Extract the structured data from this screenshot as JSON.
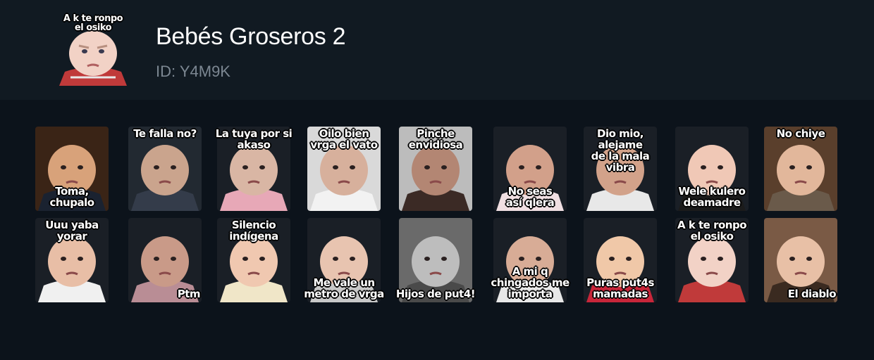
{
  "pack": {
    "title": "Bebés Groseros 2",
    "id_text": "ID: Y4M9K",
    "thumbnail_caption": "A k te ronpo\nel osiko"
  },
  "stickers": [
    {
      "caption": "Toma,\nchupalo",
      "pos": "bottom",
      "bg": "#3a2416",
      "skin": "#d8a27a",
      "shirt": "#1a2230"
    },
    {
      "caption": "Te falla no?",
      "pos": "top",
      "bg": "#222931",
      "skin": "#caa48d",
      "shirt": "#343c4a"
    },
    {
      "caption": "La tuya por si\nakaso",
      "pos": "top",
      "bg": "#1a1f26",
      "skin": "#d9b6a4",
      "shirt": "#e7a8b7"
    },
    {
      "caption": "Oilo bien\nvrga el vato",
      "pos": "top",
      "bg": "#d9d9d9",
      "skin": "#d7b09c",
      "shirt": "#f2f2f2"
    },
    {
      "caption": "Pinche\nenvidiosa",
      "pos": "top",
      "bg": "#bcbcbc",
      "skin": "#b38673",
      "shirt": "#3b2a25"
    },
    {
      "caption": "No seas\nasí qlera",
      "pos": "bottom",
      "bg": "#1a1f26",
      "skin": "#d2a08a",
      "shirt": "#f0dfe2"
    },
    {
      "caption": "Dio mio, alejame\nde la mala vibra",
      "pos": "top",
      "bg": "#1a1f26",
      "skin": "#d2a28a",
      "shirt": "#e8e8e8"
    },
    {
      "caption": "Wele kulero\ndeamadre",
      "pos": "bottom",
      "bg": "#1a1f26",
      "skin": "#f0c8b6",
      "shirt": "#1b1b1b"
    },
    {
      "caption": "No chiye",
      "pos": "top",
      "bg": "#5a3f2c",
      "skin": "#e2b79b",
      "shirt": "#6a5a4a"
    },
    {
      "caption": "Uuu yaba\nyorar",
      "pos": "top",
      "bg": "#1a1f26",
      "skin": "#e8bea6",
      "shirt": "#f0f0f0"
    },
    {
      "caption": "Ptm",
      "pos": "bottom-right",
      "bg": "#1a1f26",
      "skin": "#c99a88",
      "shirt": "#b98d95"
    },
    {
      "caption": "Silencio\nindígena",
      "pos": "top",
      "bg": "#1a1f26",
      "skin": "#f0c8b0",
      "shirt": "#f0e6c8"
    },
    {
      "caption": "Me vale un\nmetro de vrga",
      "pos": "bottom",
      "bg": "#1a1f26",
      "skin": "#e8c4b0",
      "shirt": "#c8c8c8"
    },
    {
      "caption": "Hijos de put4!",
      "pos": "bottom",
      "bg": "#6a6a6a",
      "skin": "#bdbdbd",
      "shirt": "#4a4a4a"
    },
    {
      "caption": "A mi q\nchingados me\nimporta",
      "pos": "bottom",
      "bg": "#1a1f26",
      "skin": "#d8ac96",
      "shirt": "#e8e8e8"
    },
    {
      "caption": "Puras put4s\nmamadas",
      "pos": "bottom",
      "bg": "#1a1f26",
      "skin": "#f0c8a8",
      "shirt": "#c8263a"
    },
    {
      "caption": "A k te ronpo\nel osiko",
      "pos": "top",
      "bg": "#1a1f26",
      "skin": "#f2d2c6",
      "shirt": "#c03a3a"
    },
    {
      "caption": "El diablo",
      "pos": "bottom-right",
      "bg": "#7a5a45",
      "skin": "#e8c0a6",
      "shirt": "#3a2a20"
    }
  ]
}
